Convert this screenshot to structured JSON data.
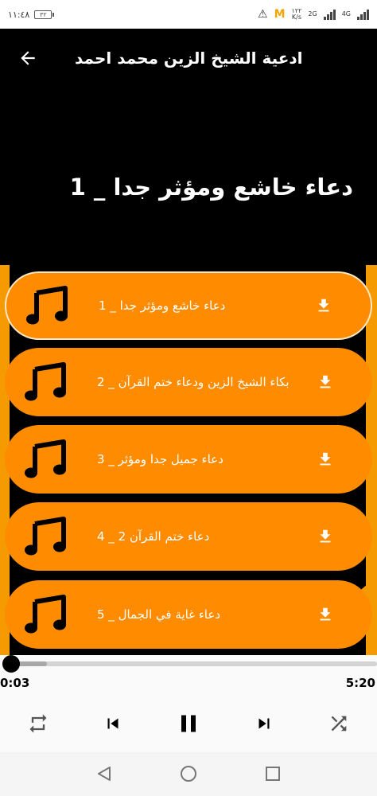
{
  "status_bar": {
    "time": "١١:٤٨",
    "battery": "٣٢",
    "speed_value": "١٢٢",
    "speed_unit": "K/s",
    "network_a": "2G",
    "network_b": "4G"
  },
  "app_bar": {
    "title": "ادعية الشيخ الزين محمد احمد"
  },
  "now_playing": {
    "title": "دعاء خاشع ومؤثر جدا _ 1"
  },
  "playlist": [
    {
      "label": "دعاء خاشع ومؤثر جدا _ 1",
      "active": true
    },
    {
      "label": "بكاء الشيخ الزين ودعاء ختم القرآن _ 2",
      "active": false
    },
    {
      "label": "دعاء جميل جدا ومؤثر _ 3",
      "active": false
    },
    {
      "label": "دعاء ختم القرآن 2 _ 4",
      "active": false
    },
    {
      "label": "دعاء غاية في الجمال _ 5",
      "active": false
    }
  ],
  "player": {
    "current_time": "0:03",
    "duration": "5:20",
    "progress_fraction": 0.01,
    "buffered_fraction": 0.11
  },
  "icons": {
    "back": "arrow-left-icon",
    "track": "music-note-icon",
    "download": "download-icon",
    "repeat": "repeat-icon",
    "previous": "skip-previous-icon",
    "pause": "pause-icon",
    "next": "skip-next-icon",
    "shuffle": "shuffle-icon"
  },
  "colors": {
    "accent": "#ff8c00",
    "background": "#000000",
    "player_background": "#fafafa"
  }
}
